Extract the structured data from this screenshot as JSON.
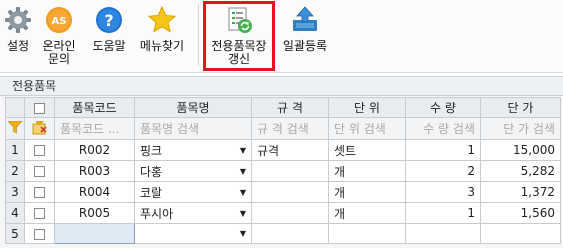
{
  "toolbar": {
    "settings_label": "설정",
    "inquiry_label_1": "온라인",
    "inquiry_label_2": "문의",
    "help_label": "도움말",
    "favorites_label": "메뉴찾기",
    "update_label_1": "전용품목장",
    "update_label_2": "갱신",
    "bulk_label": "일괄등록",
    "inquiry_badge": "AS"
  },
  "panel": {
    "title": "전용품목"
  },
  "grid": {
    "headers": [
      "품목코드",
      "품목명",
      "규 격",
      "단 위",
      "수 량",
      "단 가"
    ],
    "filters": [
      "품목코드 ...",
      "품목명 검색",
      "규 격 검색",
      "단 위 검색",
      "수 량 검색",
      "단 가 검색"
    ],
    "rows": [
      {
        "num": "1",
        "code": "R002",
        "name": "핑크",
        "spec": "규격",
        "unit": "셋트",
        "qty": "1",
        "price": "15,000"
      },
      {
        "num": "2",
        "code": "R003",
        "name": "다홍",
        "spec": "",
        "unit": "개",
        "qty": "2",
        "price": "5,282"
      },
      {
        "num": "3",
        "code": "R004",
        "name": "코랄",
        "spec": "",
        "unit": "개",
        "qty": "3",
        "price": "1,372"
      },
      {
        "num": "4",
        "code": "R005",
        "name": "푸시아",
        "spec": "",
        "unit": "개",
        "qty": "1",
        "price": "1,560"
      }
    ],
    "new_row_num": "5"
  },
  "colors": {
    "highlight": "#e0141e",
    "filter_icon": "#f0b400"
  }
}
